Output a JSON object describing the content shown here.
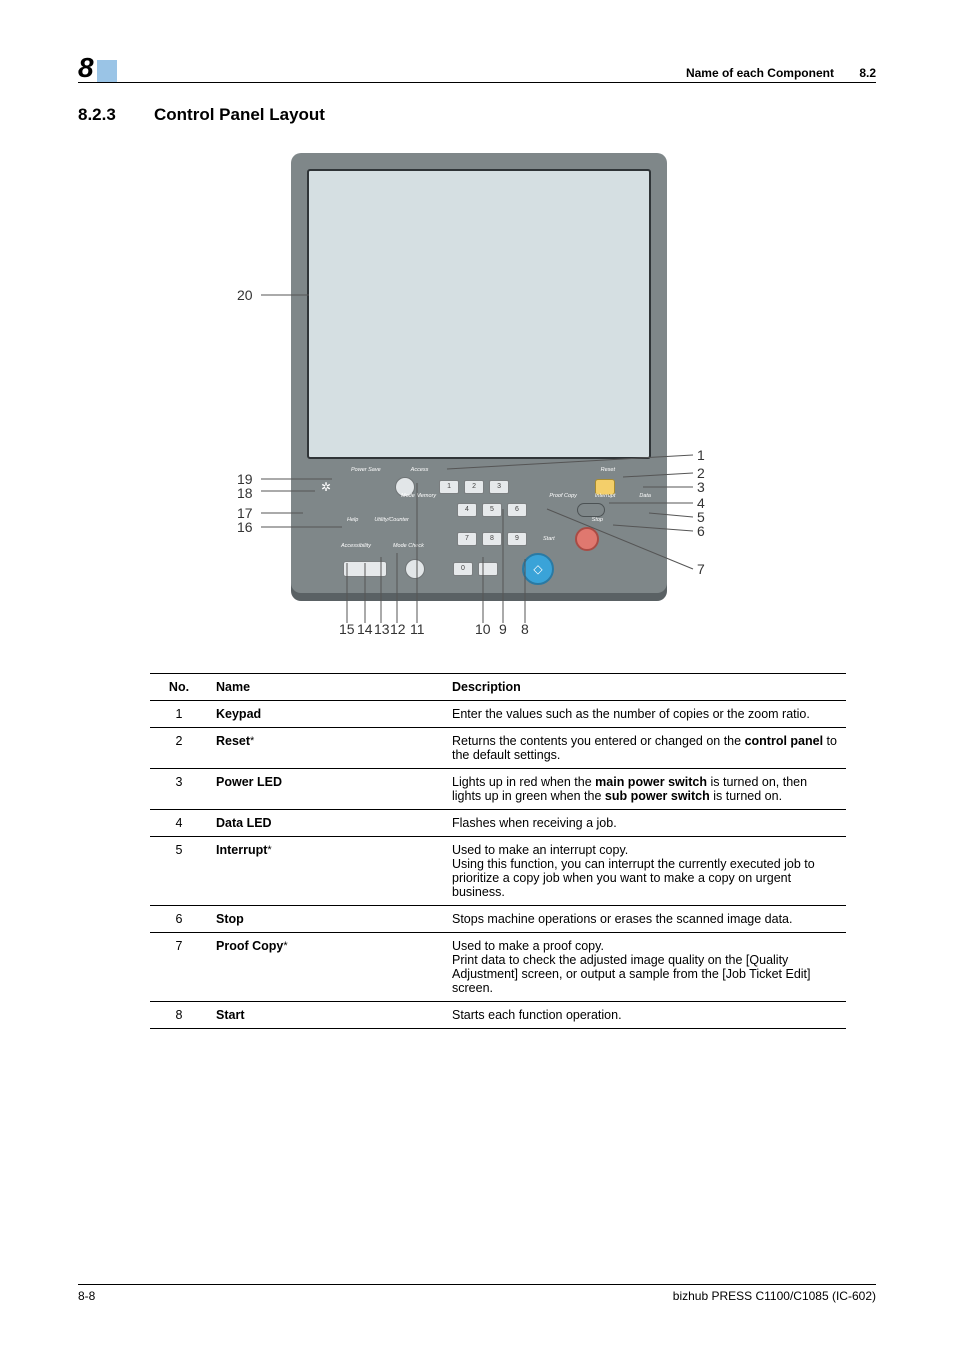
{
  "header": {
    "chapter_number": "8",
    "label": "Name of each Component",
    "section": "8.2"
  },
  "heading": {
    "number": "8.2.3",
    "title": "Control Panel Layout"
  },
  "callouts": {
    "left": [
      "20",
      "19",
      "18",
      "17",
      "16"
    ],
    "right": [
      "1",
      "2",
      "3",
      "4",
      "5",
      "6",
      "7"
    ],
    "bottom": [
      "15",
      "14",
      "13",
      "12",
      "11",
      "10",
      "9",
      "8"
    ]
  },
  "panel_labels": {
    "power_save": "Power Save",
    "access": "Access",
    "reset": "Reset",
    "data": "Data",
    "mode_memory": "Mode Memory",
    "proof_copy": "Proof Copy",
    "interrupt": "Interrupt",
    "help": "Help",
    "utility_counter": "Utility/Counter",
    "stop": "Stop",
    "accessibility": "Accessibility",
    "mode_check": "Mode Check",
    "start": "Start"
  },
  "table": {
    "headers": {
      "no": "No.",
      "name": "Name",
      "description": "Description"
    },
    "rows": [
      {
        "no": "1",
        "name": "Keypad",
        "asterisk": false,
        "desc": "Enter the values such as the number of copies or the zoom ratio."
      },
      {
        "no": "2",
        "name": "Reset",
        "asterisk": true,
        "desc_pre": "Returns the contents you entered or changed on the ",
        "desc_bold": "control panel",
        "desc_post": " to the default settings."
      },
      {
        "no": "3",
        "name": "Power LED",
        "asterisk": false,
        "desc_pre": "Lights up in red when the ",
        "desc_bold": "main power switch",
        "desc_mid": " is turned on, then lights up in green when the ",
        "desc_bold2": "sub power switch",
        "desc_post": " is turned on."
      },
      {
        "no": "4",
        "name": "Data LED",
        "asterisk": false,
        "desc": "Flashes when receiving a job."
      },
      {
        "no": "5",
        "name": "Interrupt",
        "asterisk": true,
        "desc": "Used to make an interrupt copy.\nUsing this function, you can interrupt the currently executed job to prioritize a copy job when you want to make a copy on urgent business."
      },
      {
        "no": "6",
        "name": "Stop",
        "asterisk": false,
        "desc": "Stops machine operations or erases the scanned image data."
      },
      {
        "no": "7",
        "name": "Proof Copy",
        "asterisk": true,
        "desc": "Used to make a proof copy.\nPrint data to check the adjusted image quality on the [Quality Adjustment] screen, or output a sample from the [Job Ticket Edit] screen."
      },
      {
        "no": "8",
        "name": "Start",
        "asterisk": false,
        "desc": "Starts each function operation."
      }
    ]
  },
  "footer": {
    "page": "8-8",
    "product": "bizhub PRESS C1100/C1085 (IC-602)"
  }
}
